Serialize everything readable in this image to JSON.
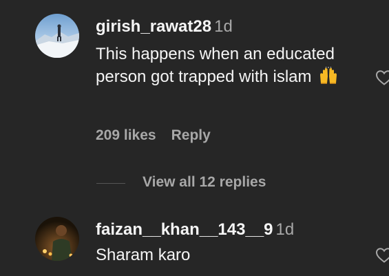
{
  "comments": [
    {
      "username": "girish_rawat28",
      "time": "1d",
      "text": "This happens when an educated person got trapped with islam",
      "emoji": "raising-hands-emoji",
      "likes": "209 likes",
      "reply_label": "Reply",
      "avatar": "snowy-mountain-avatar"
    },
    {
      "username": "faizan__khan__143__9",
      "time": "1d",
      "text": "Sharam karo",
      "avatar": "person-candlelight-avatar"
    }
  ],
  "view_replies": "View all 12 replies",
  "colors": {
    "background": "#262626",
    "primary_text": "#f5f5f5",
    "secondary_text": "#a8a8a8"
  },
  "icons": [
    "heart-icon",
    "raising-hands-emoji"
  ]
}
